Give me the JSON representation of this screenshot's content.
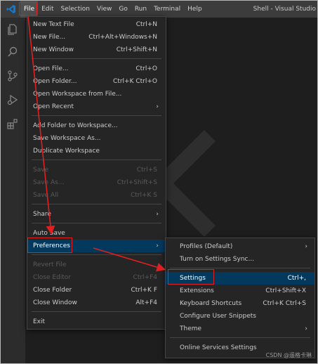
{
  "titlebar": {
    "menu": [
      "File",
      "Edit",
      "Selection",
      "View",
      "Go",
      "Run",
      "Terminal",
      "Help"
    ],
    "title": "Shell - Visual Studio"
  },
  "activity_icons": [
    "files-icon",
    "search-icon",
    "source-control-icon",
    "run-debug-icon",
    "extensions-icon"
  ],
  "file_menu": {
    "items": [
      {
        "label": "New Text File",
        "key": "Ctrl+N"
      },
      {
        "label": "New File...",
        "key": "Ctrl+Alt+Windows+N"
      },
      {
        "label": "New Window",
        "key": "Ctrl+Shift+N"
      },
      {
        "label": "Open File...",
        "key": "Ctrl+O"
      },
      {
        "label": "Open Folder...",
        "key": "Ctrl+K Ctrl+O"
      },
      {
        "label": "Open Workspace from File...",
        "key": ""
      },
      {
        "label": "Open Recent",
        "key": ""
      },
      {
        "label": "Add Folder to Workspace...",
        "key": ""
      },
      {
        "label": "Save Workspace As...",
        "key": ""
      },
      {
        "label": "Duplicate Workspace",
        "key": ""
      },
      {
        "label": "Save",
        "key": "Ctrl+S"
      },
      {
        "label": "Save As...",
        "key": "Ctrl+Shift+S"
      },
      {
        "label": "Save All",
        "key": "Ctrl+K S"
      },
      {
        "label": "Share",
        "key": ""
      },
      {
        "label": "Auto Save",
        "key": ""
      },
      {
        "label": "Preferences",
        "key": ""
      },
      {
        "label": "Revert File",
        "key": ""
      },
      {
        "label": "Close Editor",
        "key": "Ctrl+F4"
      },
      {
        "label": "Close Folder",
        "key": "Ctrl+K F"
      },
      {
        "label": "Close Window",
        "key": "Alt+F4"
      },
      {
        "label": "Exit",
        "key": ""
      }
    ]
  },
  "pref_menu": {
    "items": [
      {
        "label": "Profiles (Default)",
        "key": ""
      },
      {
        "label": "Turn on Settings Sync...",
        "key": ""
      },
      {
        "label": "Settings",
        "key": "Ctrl+,"
      },
      {
        "label": "Extensions",
        "key": "Ctrl+Shift+X"
      },
      {
        "label": "Keyboard Shortcuts",
        "key": "Ctrl+K Ctrl+S"
      },
      {
        "label": "Configure User Snippets",
        "key": ""
      },
      {
        "label": "Theme",
        "key": ""
      },
      {
        "label": "Online Services Settings",
        "key": ""
      }
    ]
  },
  "watermark": "CSDN @遥格卡琳",
  "colors": {
    "highlight": "#e02020",
    "selection": "#04395e",
    "accent": "#0e7ad3"
  }
}
